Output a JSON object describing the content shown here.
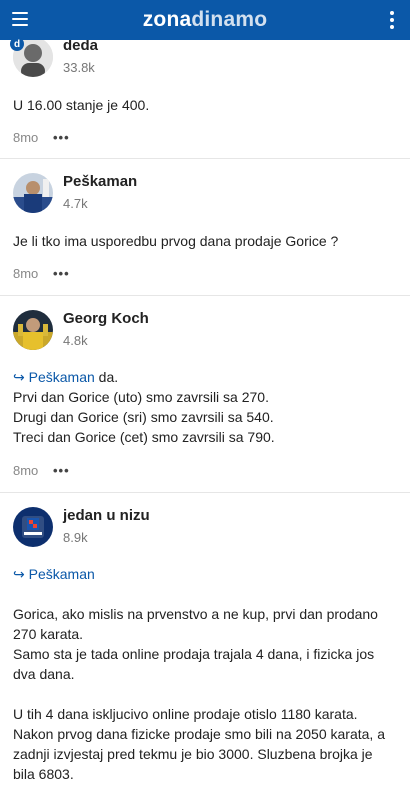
{
  "header": {
    "logo_part1": "zona",
    "logo_part2": "dinamo"
  },
  "comments": [
    {
      "username": "deda",
      "points": "33.8k",
      "badge": "d",
      "text": "U 16.00 stanje je 400.",
      "time": "8mo",
      "more": "•••"
    },
    {
      "username": "Peškaman",
      "points": "4.7k",
      "text": "Je li tko ima usporedbu prvog dana prodaje Gorice ?",
      "time": "8mo",
      "more": "•••"
    },
    {
      "username": "Georg Koch",
      "points": "4.8k",
      "reply_to": "↪ Peškaman",
      "reply_suffix": " da.",
      "lines": [
        "Prvi dan Gorice (uto) smo zavrsili sa 270.",
        "Drugi dan Gorice (sri) smo zavrsili sa 540.",
        "Treci dan Gorice (cet) smo zavrsili sa 790."
      ],
      "time": "8mo",
      "more": "•••"
    },
    {
      "username": "jedan u nizu",
      "points": "8.9k",
      "reply_to": "↪ Peškaman",
      "paragraphs": [
        "Gorica, ako mislis na prvenstvo a ne kup, prvi dan prodano 270 karata.",
        "Samo sta je tada online prodaja trajala 4 dana, i fizicka jos dva dana.",
        "U tih 4 dana iskljucivo online prodaje otislo 1180 karata. Nakon prvog dana fizicke prodaje smo bili na 2050 karata, a zadnji izvjestaj pred tekmu je bio 3000. Sluzbena brojka je bila 6803."
      ]
    }
  ]
}
